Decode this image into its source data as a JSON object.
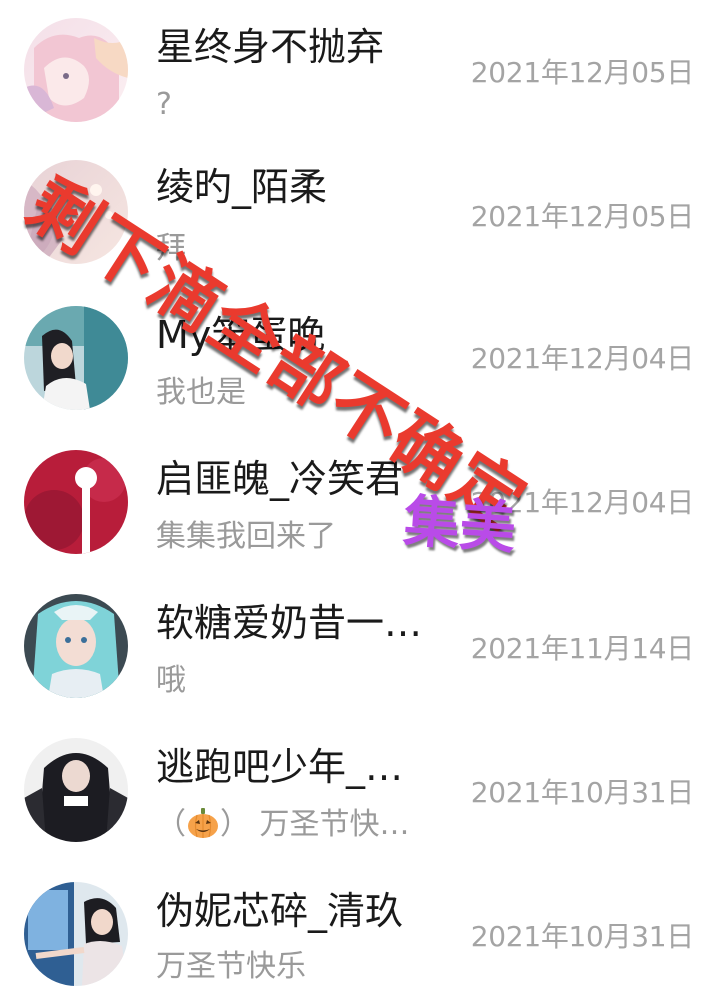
{
  "chats": [
    {
      "name": "星终身不抛弃",
      "preview": "?",
      "date": "2021年12月05日",
      "avatar": "anime-girl-pink-avatar"
    },
    {
      "name": "绫旳_陌柔",
      "preview": "拜",
      "date": "2021年12月05日",
      "avatar": "soft-pastel-avatar"
    },
    {
      "name": "My笨蛋晚",
      "preview": "我也是",
      "date": "2021年12月04日",
      "avatar": "girl-photo-avatar"
    },
    {
      "name": "启匪魄_冷笑君",
      "preview": "集集我回来了",
      "date": "2021年12月04日",
      "avatar": "red-moon-avatar"
    },
    {
      "name": "软糖爱奶昔一…",
      "preview": "哦",
      "date": "2021年11月14日",
      "avatar": "teal-hair-avatar"
    },
    {
      "name": "逃跑吧少年_…",
      "preview_prefix": "（",
      "preview_suffix": "） 万圣节快…",
      "date": "2021年10月31日",
      "avatar": "dark-outfit-avatar"
    },
    {
      "name": "伪妮芯碎_清玖",
      "preview": "万圣节快乐",
      "date": "2021年10月31日",
      "avatar": "window-girl-avatar"
    }
  ],
  "overlays": {
    "red_text": "剩下滴全部不确定",
    "red_color": "#ea3a2e",
    "purple_text": "集美",
    "purple_color": "#b94be8"
  }
}
